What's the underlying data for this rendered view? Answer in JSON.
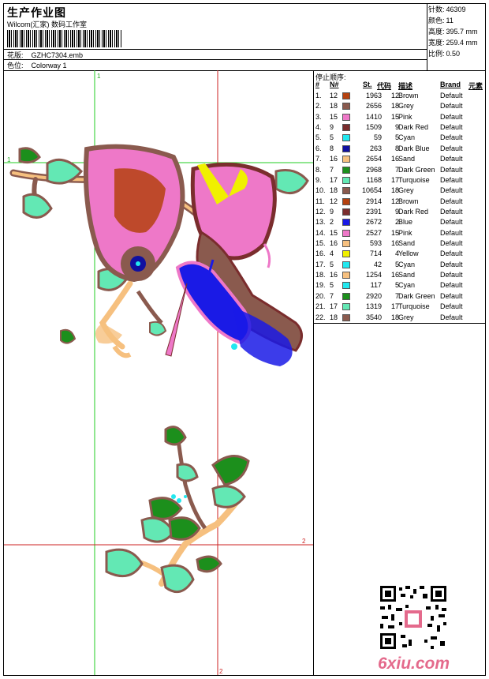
{
  "header": {
    "title": "生产作业图",
    "studio": "Wilcom(汇家) 数码工作室",
    "design_label": "花版:",
    "design_value": "GZHC7304.emb",
    "colorway_label": "色位:",
    "colorway_value": "Colorway 1"
  },
  "stats": [
    {
      "label": "针数:",
      "value": "46309"
    },
    {
      "label": "颜色:",
      "value": "11"
    },
    {
      "label": "高度:",
      "value": "395.7 mm"
    },
    {
      "label": "宽度:",
      "value": "259.4 mm"
    },
    {
      "label": "比例:",
      "value": "0.50"
    }
  ],
  "guides": {
    "marker_1": "1",
    "marker_2": "2"
  },
  "sequence": {
    "title": "停止顺序:",
    "headers": {
      "num": "#",
      "needle": "N#",
      "stitches": "St.",
      "code": "代码",
      "desc": "描述",
      "brand": "Brand",
      "elem": "元素"
    },
    "rows": [
      {
        "n": "1.",
        "needle": "12",
        "color": "#b5410f",
        "st": "1963",
        "code": "12",
        "desc": "Brown",
        "brand": "Default"
      },
      {
        "n": "2.",
        "needle": "18",
        "color": "#8a5a4e",
        "st": "2656",
        "code": "18",
        "desc": "Grey",
        "brand": "Default"
      },
      {
        "n": "3.",
        "needle": "15",
        "color": "#ee78c8",
        "st": "1410",
        "code": "15",
        "desc": "Pink",
        "brand": "Default"
      },
      {
        "n": "4.",
        "needle": "9",
        "color": "#7a2d2d",
        "st": "1509",
        "code": "9",
        "desc": "Dark Red",
        "brand": "Default"
      },
      {
        "n": "5.",
        "needle": "5",
        "color": "#22e8ef",
        "st": "59",
        "code": "5",
        "desc": "Cyan",
        "brand": "Default"
      },
      {
        "n": "6.",
        "needle": "8",
        "color": "#1010a0",
        "st": "263",
        "code": "8",
        "desc": "Dark Blue",
        "brand": "Default"
      },
      {
        "n": "7.",
        "needle": "16",
        "color": "#f6c07f",
        "st": "2654",
        "code": "16",
        "desc": "Sand",
        "brand": "Default"
      },
      {
        "n": "8.",
        "needle": "7",
        "color": "#1c8f1c",
        "st": "2968",
        "code": "7",
        "desc": "Dark Green",
        "brand": "Default"
      },
      {
        "n": "9.",
        "needle": "17",
        "color": "#63e8b4",
        "st": "1168",
        "code": "17",
        "desc": "Turquoise",
        "brand": "Default"
      },
      {
        "n": "10.",
        "needle": "18",
        "color": "#8a5a4e",
        "st": "10654",
        "code": "18",
        "desc": "Grey",
        "brand": "Default"
      },
      {
        "n": "11.",
        "needle": "12",
        "color": "#b5410f",
        "st": "2914",
        "code": "12",
        "desc": "Brown",
        "brand": "Default"
      },
      {
        "n": "12.",
        "needle": "9",
        "color": "#7a2d2d",
        "st": "2391",
        "code": "9",
        "desc": "Dark Red",
        "brand": "Default"
      },
      {
        "n": "13.",
        "needle": "2",
        "color": "#1a1ae6",
        "st": "2672",
        "code": "2",
        "desc": "Blue",
        "brand": "Default"
      },
      {
        "n": "14.",
        "needle": "15",
        "color": "#ee78c8",
        "st": "2527",
        "code": "15",
        "desc": "Pink",
        "brand": "Default"
      },
      {
        "n": "15.",
        "needle": "16",
        "color": "#f6c07f",
        "st": "593",
        "code": "16",
        "desc": "Sand",
        "brand": "Default"
      },
      {
        "n": "16.",
        "needle": "4",
        "color": "#f0f000",
        "st": "714",
        "code": "4",
        "desc": "Yellow",
        "brand": "Default"
      },
      {
        "n": "17.",
        "needle": "5",
        "color": "#22e8ef",
        "st": "42",
        "code": "5",
        "desc": "Cyan",
        "brand": "Default"
      },
      {
        "n": "18.",
        "needle": "16",
        "color": "#f6c07f",
        "st": "1254",
        "code": "16",
        "desc": "Sand",
        "brand": "Default"
      },
      {
        "n": "19.",
        "needle": "5",
        "color": "#22e8ef",
        "st": "117",
        "code": "5",
        "desc": "Cyan",
        "brand": "Default"
      },
      {
        "n": "20.",
        "needle": "7",
        "color": "#1c8f1c",
        "st": "2920",
        "code": "7",
        "desc": "Dark Green",
        "brand": "Default"
      },
      {
        "n": "21.",
        "needle": "17",
        "color": "#63e8b4",
        "st": "1319",
        "code": "17",
        "desc": "Turquoise",
        "brand": "Default"
      },
      {
        "n": "22.",
        "needle": "18",
        "color": "#8a5a4e",
        "st": "3540",
        "code": "18",
        "desc": "Grey",
        "brand": "Default"
      }
    ]
  },
  "watermark": "6xiu.com",
  "icons": {
    "qr": "qr-code-icon"
  }
}
